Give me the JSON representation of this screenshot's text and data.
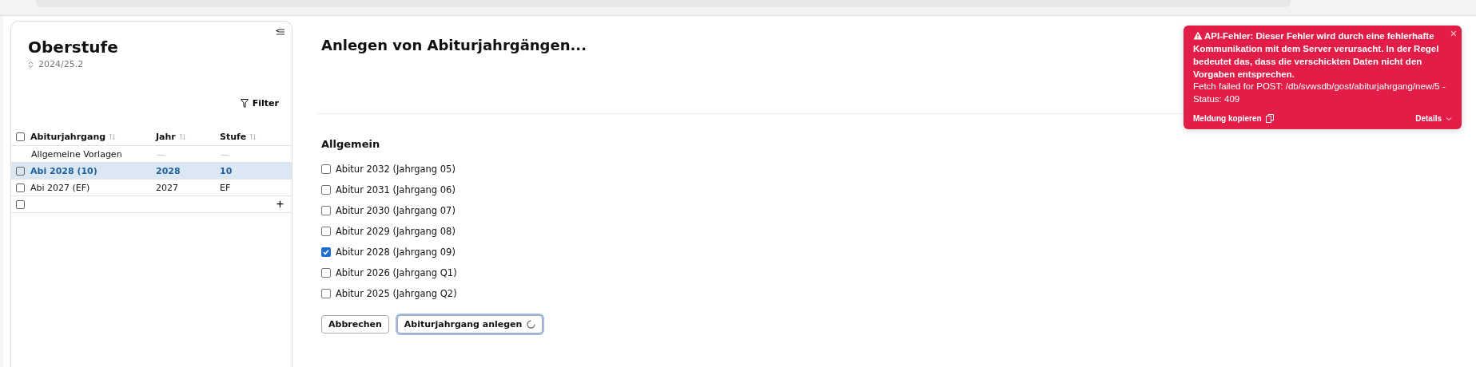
{
  "sidebar": {
    "title": "Oberstufe",
    "school_year": "2024/25.2",
    "filter_label": "Filter",
    "table": {
      "select_all_checked": false,
      "columns": [
        "Abiturjahrgang",
        "Jahr",
        "Stufe"
      ],
      "rows": [
        {
          "kind": "template",
          "cells": [
            "Allgemeine Vorlagen",
            "—",
            "—"
          ],
          "selected": false
        },
        {
          "kind": "item",
          "cells": [
            "Abi 2028 (10)",
            "2028",
            "10"
          ],
          "selected": true,
          "checked": false
        },
        {
          "kind": "item",
          "cells": [
            "Abi 2027 (EF)",
            "2027",
            "EF"
          ],
          "selected": false,
          "checked": false
        }
      ],
      "new_row_checked": false,
      "add_label": "+"
    }
  },
  "main": {
    "title": "Anlegen von Abiturjahrgängen...",
    "section": "Allgemein",
    "options": [
      {
        "label": "Abitur 2032 (Jahrgang 05)",
        "checked": false
      },
      {
        "label": "Abitur 2031 (Jahrgang 06)",
        "checked": false
      },
      {
        "label": "Abitur 2030 (Jahrgang 07)",
        "checked": false
      },
      {
        "label": "Abitur 2029 (Jahrgang 08)",
        "checked": false
      },
      {
        "label": "Abitur 2028 (Jahrgang 09)",
        "checked": true
      },
      {
        "label": "Abitur 2026 (Jahrgang Q1)",
        "checked": false
      },
      {
        "label": "Abitur 2025 (Jahrgang Q2)",
        "checked": false
      }
    ],
    "buttons": [
      {
        "label": "Abbrechen",
        "kind": "secondary"
      },
      {
        "label": "Abiturjahrgang anlegen",
        "kind": "primary-loading"
      }
    ]
  },
  "toast": {
    "close_label": "×",
    "title": "API-Fehler: Dieser Fehler wird durch eine fehlerhafte Kommunikation mit dem Server verursacht. In der Regel bedeutet das, dass die verschickten Daten nicht den Vorgaben entsprechen.",
    "detail": "Fetch failed for POST: /db/svwsdb/gost/abiturjahrgang/new/5 - Status: 409",
    "copy_label": "Meldung kopieren",
    "details_label": "Details"
  }
}
